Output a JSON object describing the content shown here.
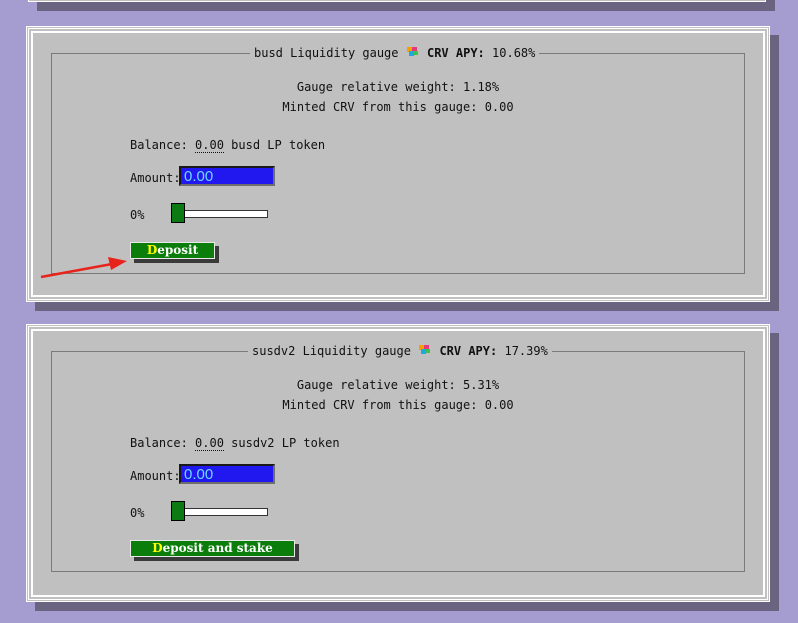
{
  "gauges": [
    {
      "pool": "busd",
      "title_suffix": "Liquidity gauge",
      "crv_label": "CRV APY:",
      "apy": "10.68%",
      "weight_text": "Gauge relative weight: 1.18%",
      "minted_text": "Minted CRV from this gauge: 0.00",
      "balance_label": "Balance:",
      "balance_value": "0.00",
      "balance_unit": "busd LP token",
      "amount_label": "Amount:",
      "amount_value": "0.00",
      "slider_label": "0%",
      "slider_percent": 0,
      "button_first": "D",
      "button_rest": "eposit"
    },
    {
      "pool": "susdv2",
      "title_suffix": "Liquidity gauge",
      "crv_label": "CRV APY:",
      "apy": "17.39%",
      "weight_text": "Gauge relative weight: 5.31%",
      "minted_text": "Minted CRV from this gauge: 0.00",
      "balance_label": "Balance:",
      "balance_value": "0.00",
      "balance_unit": "susdv2 LP token",
      "amount_label": "Amount:",
      "amount_value": "0.00",
      "slider_label": "0%",
      "slider_percent": 0,
      "button_first": "D",
      "button_rest": "eposit and stake"
    }
  ],
  "colors": {
    "background": "#a59ccf",
    "panel": "#c0c0c0",
    "input_bg": "#2118f0",
    "button_bg": "#0b7d0b",
    "arrow": "#e8231c"
  },
  "annotation": {
    "icon": "red-arrow-icon"
  }
}
